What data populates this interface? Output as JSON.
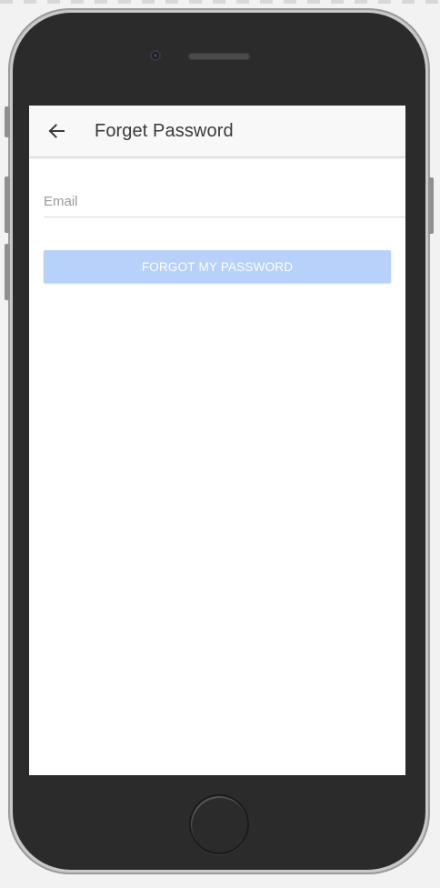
{
  "appbar": {
    "back_icon": "arrow-left-icon",
    "title": "Forget Password"
  },
  "form": {
    "email_placeholder": "Email",
    "email_value": "",
    "submit_label": "FORGOT MY PASSWORD"
  },
  "colors": {
    "button_bg": "#b7d1fb",
    "button_text": "#ffffff",
    "appbar_bg": "#f8f8f8",
    "device_body": "#2b2b2b"
  }
}
